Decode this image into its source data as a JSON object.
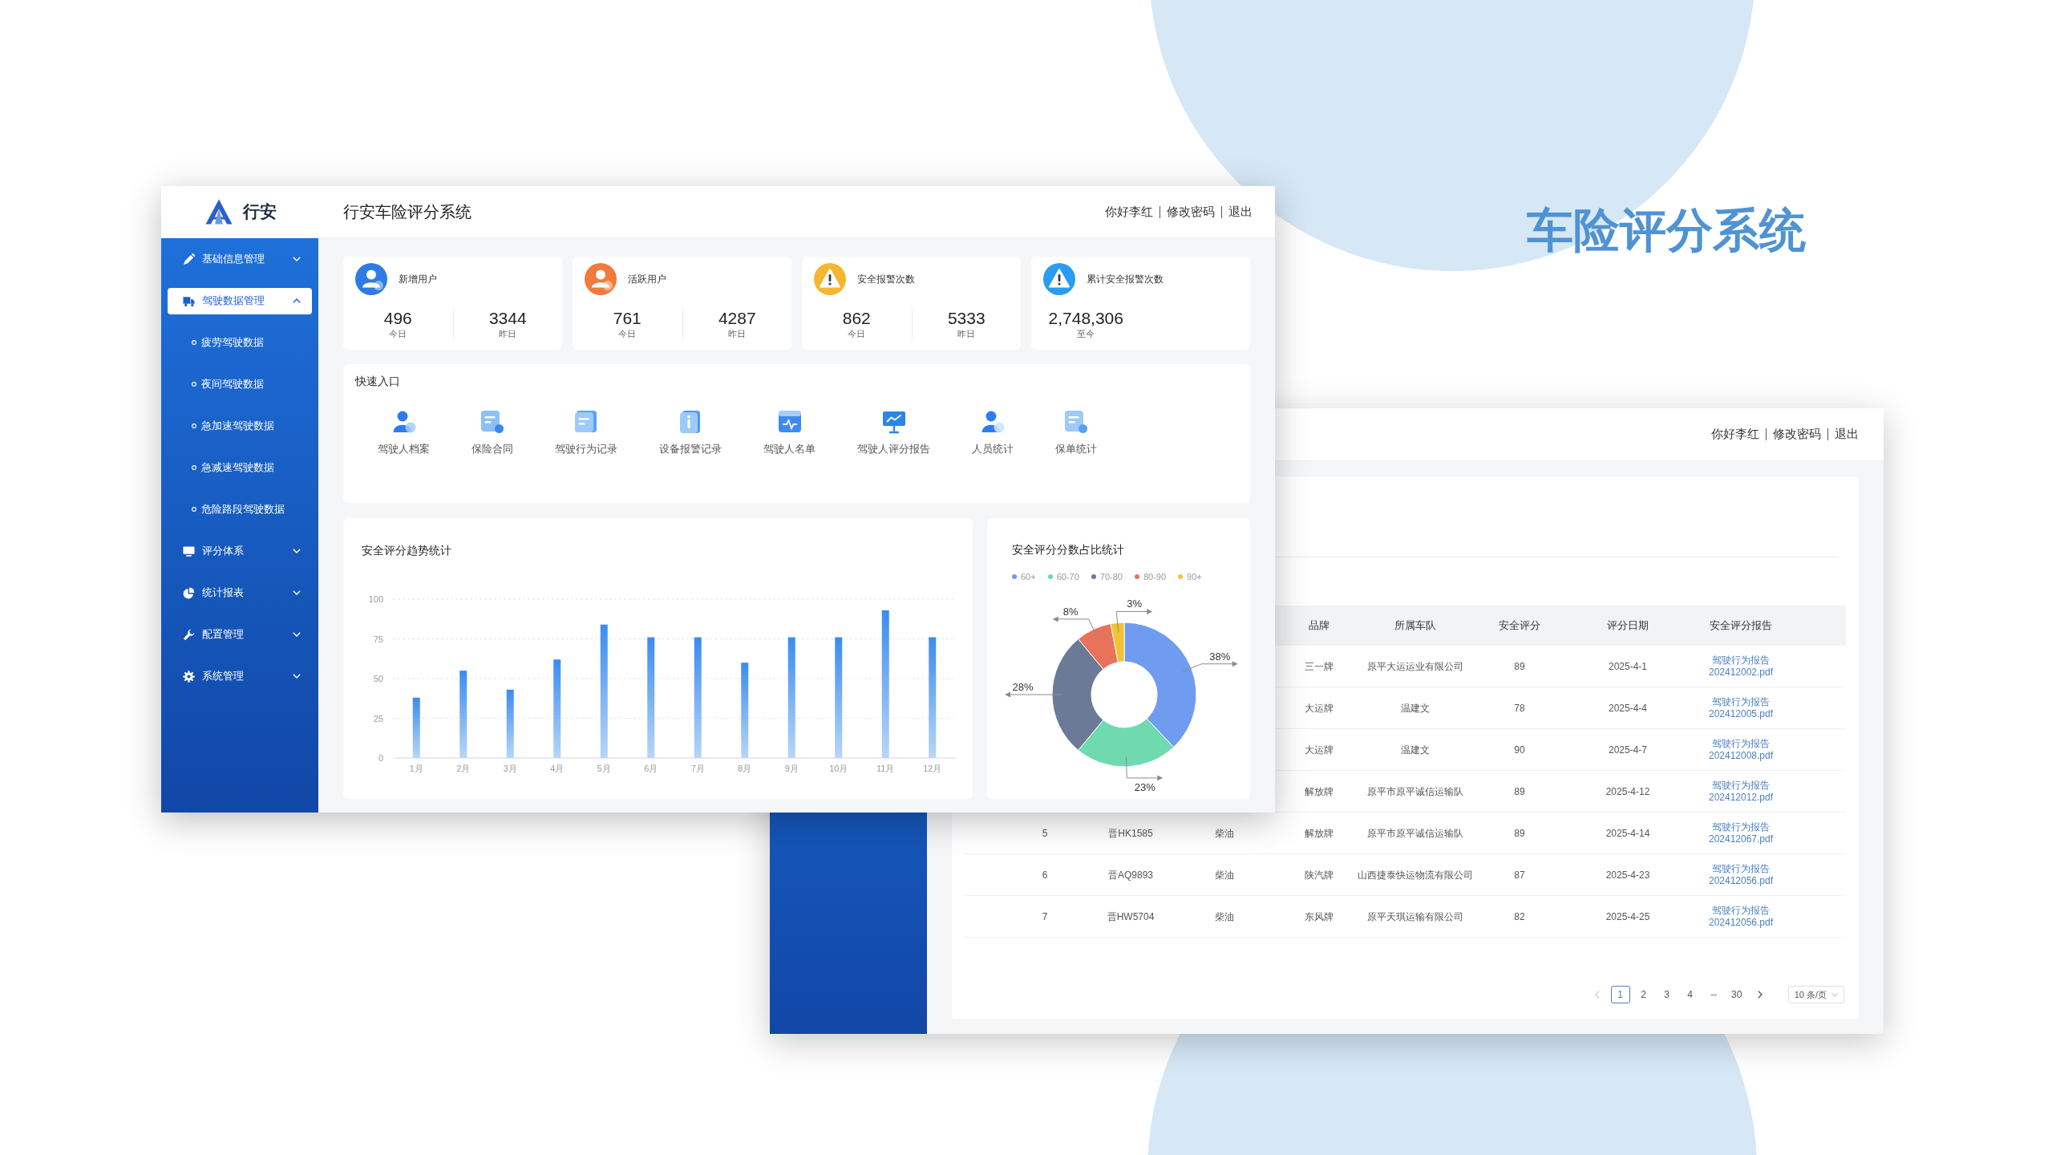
{
  "slide": {
    "title": "车险评分系统"
  },
  "back_window": {
    "user_menu": [
      "你好李红",
      "修改密码",
      "退出"
    ],
    "table": {
      "columns": [
        "品牌",
        "所属车队",
        "安全评分",
        "评分日期",
        "安全评分报告"
      ],
      "rows": [
        {
          "cells": [
            "三一牌",
            "原平大运运业有限公司",
            "89",
            "2025-4-1"
          ],
          "report": [
            "驾驶行为报告",
            "202412002.pdf"
          ]
        },
        {
          "cells": [
            "大运牌",
            "温建文",
            "78",
            "2025-4-4"
          ],
          "report": [
            "驾驶行为报告",
            "202412005.pdf"
          ]
        },
        {
          "cells": [
            "大运牌",
            "温建文",
            "90",
            "2025-4-7"
          ],
          "report": [
            "驾驶行为报告",
            "202412008.pdf"
          ]
        },
        {
          "cells": [
            "解放牌",
            "原平市原平诚信运输队",
            "89",
            "2025-4-12"
          ],
          "report": [
            "驾驶行为报告",
            "202412012.pdf"
          ]
        },
        {
          "cells": [
            "5",
            "晋HK1585",
            "柴油",
            "解放牌",
            "原平市原平诚信运输队",
            "89",
            "2025-4-14"
          ],
          "report": [
            "驾驶行为报告",
            "202412067.pdf"
          ]
        },
        {
          "cells": [
            "6",
            "晋AQ9893",
            "柴油",
            "陕汽牌",
            "山西捷泰快运物流有限公司",
            "87",
            "2025-4-23"
          ],
          "report": [
            "驾驶行为报告",
            "202412056.pdf"
          ]
        },
        {
          "cells": [
            "7",
            "晋HW5704",
            "柴油",
            "东风牌",
            "原平天琪运输有限公司",
            "82",
            "2025-4-25"
          ],
          "report": [
            "驾驶行为报告",
            "202412056.pdf"
          ]
        }
      ]
    },
    "pagination": {
      "prev": {
        "disabled": true
      },
      "pages": [
        {
          "label": "1",
          "kind": "page",
          "selected": true
        },
        {
          "label": "2",
          "kind": "page",
          "selected": false
        },
        {
          "label": "3",
          "kind": "page",
          "selected": false
        },
        {
          "label": "4",
          "kind": "page",
          "selected": false
        },
        {
          "label": "•••",
          "kind": "ellipsis",
          "selected": false
        },
        {
          "label": "30",
          "kind": "page",
          "selected": false
        }
      ],
      "next": {
        "disabled": false
      },
      "page_size": "10 条/页"
    }
  },
  "front_window": {
    "brand": "行安",
    "title": "行安车险评分系统",
    "user_menu": [
      "你好李红",
      "修改密码",
      "退出"
    ],
    "sidebar": {
      "items": [
        {
          "label": "基础信息管理",
          "selected": false,
          "expanded": false
        },
        {
          "label": "驾驶数据管理",
          "selected": true,
          "expanded": true,
          "children": [
            {
              "label": "疲劳驾驶数据",
              "selected": false
            },
            {
              "label": "夜间驾驶数据",
              "selected": false
            },
            {
              "label": "急加速驾驶数据",
              "selected": false
            },
            {
              "label": "急减速驾驶数据",
              "selected": false
            },
            {
              "label": "危险路段驾驶数据",
              "selected": false
            }
          ]
        },
        {
          "label": "评分体系",
          "selected": false,
          "expanded": false
        },
        {
          "label": "统计报表",
          "selected": false,
          "expanded": false
        },
        {
          "label": "配置管理",
          "selected": false,
          "expanded": false
        },
        {
          "label": "系统管理",
          "selected": false,
          "expanded": false
        }
      ]
    },
    "stats": [
      {
        "title": "新增用户",
        "color": "#2f7be6",
        "stats": [
          {
            "value": "496",
            "label": "今日"
          },
          {
            "value": "3344",
            "label": "昨日"
          }
        ]
      },
      {
        "title": "活跃用户",
        "color": "#f27a3c",
        "stats": [
          {
            "value": "761",
            "label": "今日"
          },
          {
            "value": "4287",
            "label": "昨日"
          }
        ]
      },
      {
        "title": "安全报警次数",
        "color": "#f5b731",
        "stats": [
          {
            "value": "862",
            "label": "今日"
          },
          {
            "value": "5333",
            "label": "昨日"
          }
        ]
      },
      {
        "title": "累计安全报警次数",
        "color": "#2a9cf2",
        "stats": [
          {
            "value": "2,748,306",
            "label": "至今"
          }
        ]
      }
    ],
    "quick_entry": {
      "title": "快速入口",
      "items": [
        "驾驶人档案",
        "保险合同",
        "驾驶行为记录",
        "设备报警记录",
        "驾驶人名单",
        "驾驶人评分报告",
        "人员统计",
        "保单统计"
      ]
    },
    "trend_chart": {
      "chart_data": {
        "type": "bar",
        "title": "安全评分趋势统计",
        "categories": [
          "1月",
          "2月",
          "3月",
          "4月",
          "5月",
          "6月",
          "7月",
          "8月",
          "9月",
          "10月",
          "11月",
          "12月"
        ],
        "values": [
          38,
          55,
          43,
          62,
          84,
          76,
          76,
          60,
          76,
          76,
          93,
          76
        ],
        "ylim": [
          0,
          100
        ],
        "yticks": [
          0,
          25,
          50,
          75,
          100
        ],
        "grid": true
      }
    },
    "ratio_chart": {
      "chart_data": {
        "type": "donut",
        "title": "安全评分分数占比统计",
        "legend": "top",
        "categories": [
          "60+",
          "60-70",
          "70-80",
          "80-90",
          "90+"
        ],
        "values": [
          38,
          23,
          28,
          8,
          3
        ],
        "colors": [
          "#6f9bf0",
          "#6fd9b0",
          "#6b7a96",
          "#e8735a",
          "#f1c232"
        ],
        "value_labels": [
          "38%",
          "23%",
          "28%",
          "8%",
          "3%"
        ]
      }
    }
  }
}
